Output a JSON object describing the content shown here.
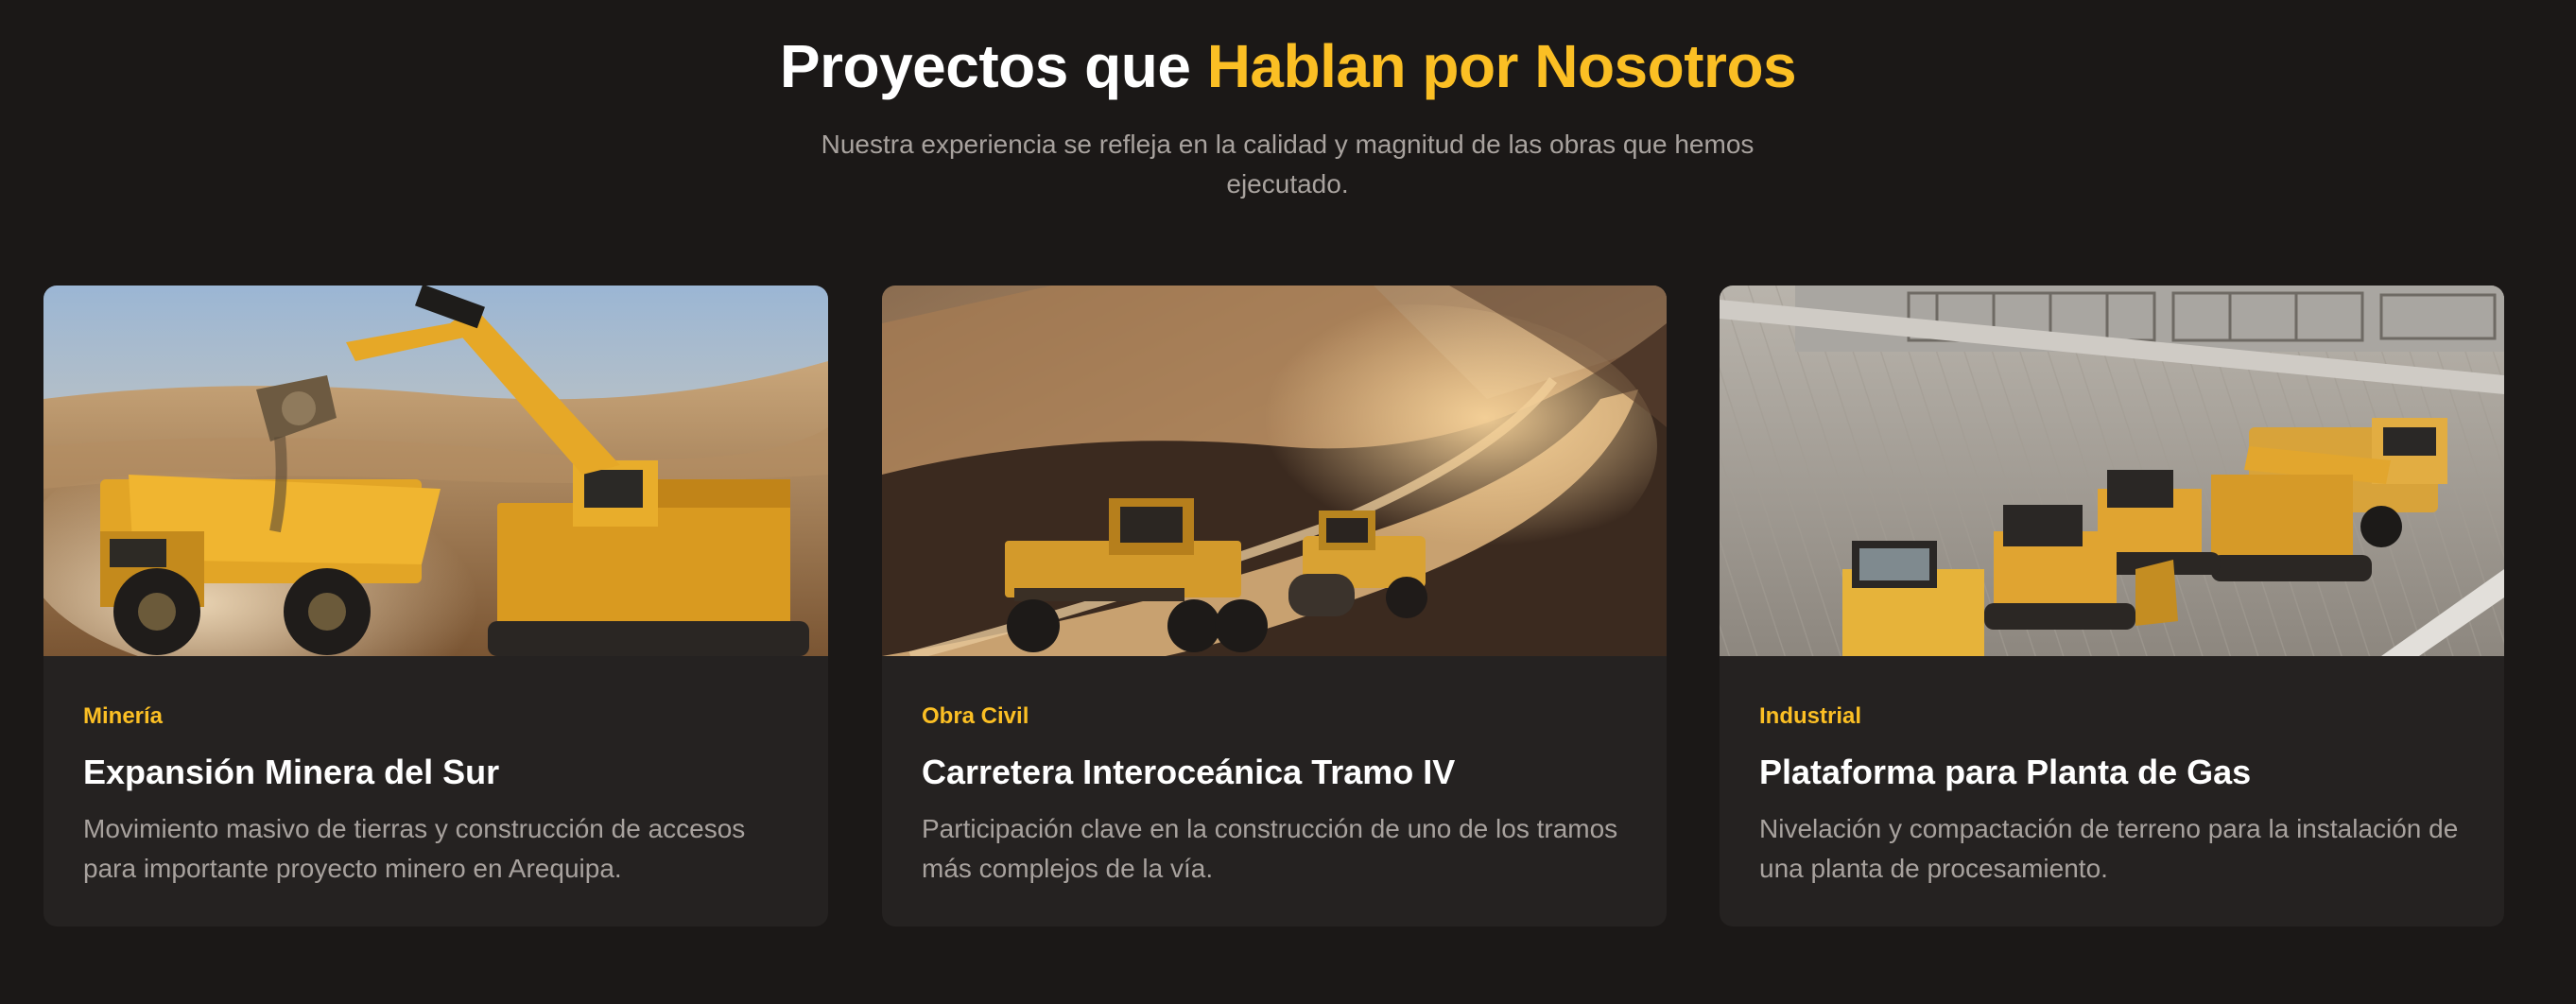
{
  "section": {
    "title_main": "Proyectos que ",
    "title_accent": "Hablan por Nosotros",
    "subtitle": "Nuestra experiencia se refleja en la calidad y magnitud de las obras que hemos ejecutado."
  },
  "projects": [
    {
      "category": "Minería",
      "title": "Expansión Minera del Sur",
      "description": "Movimiento masivo de tierras y construcción de accesos para importante proyecto minero en Arequipa."
    },
    {
      "category": "Obra Civil",
      "title": "Carretera Interoceánica Tramo IV",
      "description": "Participación clave en la construcción de uno de los tramos más complejos de la vía."
    },
    {
      "category": "Industrial",
      "title": "Plataforma para Planta de Gas",
      "description": "Nivelación y compactación de terreno para la instalación de una planta de procesamiento."
    }
  ],
  "colors": {
    "background": "#1b1817",
    "card": "#252221",
    "accent": "#fbbf24",
    "muted_text": "#a8a29e"
  }
}
